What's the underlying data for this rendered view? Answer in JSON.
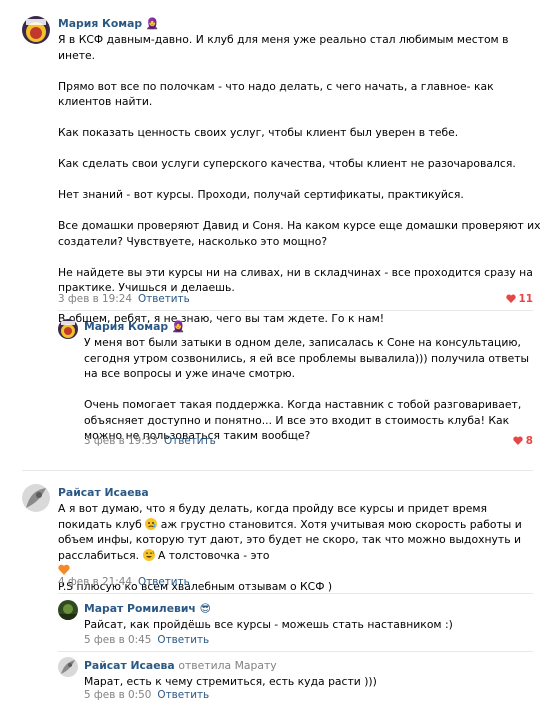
{
  "comments": [
    {
      "author": "Мария Комар",
      "emoji": "🧕",
      "paragraphs": [
        "Я в КСФ давным-давно. И клуб для меня уже реально стал любимым местом в инете.",
        "Прямо вот все по полочкам - что надо делать, с чего начать, а главное- как клиентов найти.",
        "Как показать ценность своих услуг, чтобы клиент был уверен в тебе.",
        "Как сделать свои услуги суперского качества, чтобы клиент не разочаровался.",
        "Нет знаний - вот курсы. Проходи, получай сертификаты, практикуйся.",
        "Все домашки проверяют Давид и Соня. На каком курсе еще домашки проверяют их создатели? Чувствуете, насколько это мощно?",
        "Не найдете вы эти курсы ни на сливах, ни в складчинах - все проходится сразу на практике. Учишься и делаешь.",
        "В общем, ребят, я не знаю, чего вы там ждете. Го к нам!"
      ],
      "date": "3 фев в 19:24",
      "reply_label": "Ответить",
      "likes": "11"
    },
    {
      "author": "Мария Комар",
      "emoji": "🧕",
      "paragraphs": [
        "У меня вот были затыки в одном деле, записалась к Соне на консультацию, сегодня утром созвонились, я ей все проблемы вывалила))) получила ответы на все вопросы и уже иначе смотрю.",
        "Очень помогает такая поддержка. Когда наставник с тобой разговаривает, объясняет доступно и понятно... И все это входит в стоимость клуба! Как можно не пользоваться таким вообще?"
      ],
      "date": "3 фев в 19:33",
      "reply_label": "Ответить",
      "likes": "8"
    },
    {
      "author": "Райсат Исаева",
      "text_a": "А я вот думаю, что я буду делать, когда пройду все курсы и придет время покидать клуб",
      "text_b": "аж грустно становится. Хотя учитывая мою скорость работы и объем инфы, которую тут дают, это будет не скоро, так что можно выдохнуть и расслабиться.",
      "text_c": "А толстовочка - это",
      "text_d": "P.S плюсую ко всем хвалебным отзывам о КСФ )",
      "date": "4 фев в 21:44",
      "reply_label": "Ответить"
    },
    {
      "author": "Марат Ромилевич",
      "emoji": "😎",
      "text": "Райсат, как пройдёшь все курсы - можешь стать наставником :)",
      "date": "5 фев в 0:45",
      "reply_label": "Ответить"
    },
    {
      "author": "Райсат Исаева",
      "replied_to": "ответила Марату",
      "text": "Марат, есть к чему стремиться, есть куда расти )))",
      "date": "5 фев в 0:50",
      "reply_label": "Ответить"
    }
  ]
}
